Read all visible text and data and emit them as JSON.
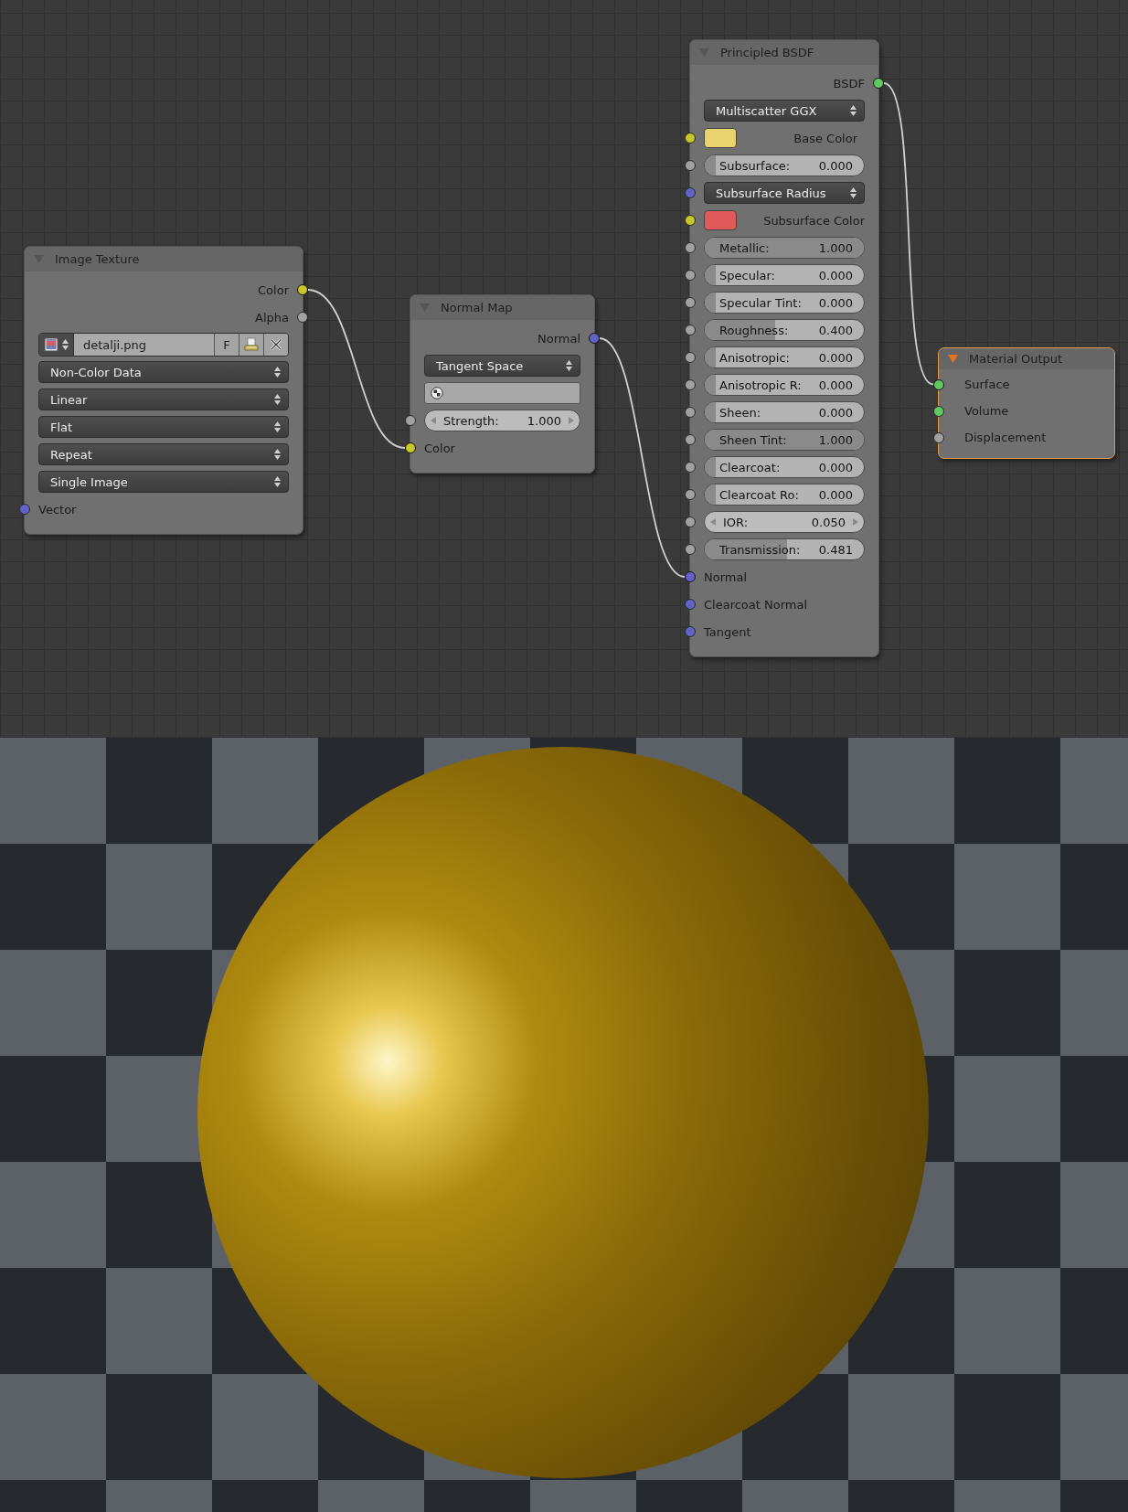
{
  "nodes": [
    {
      "title": "Image Texture",
      "selected": false,
      "rows": [
        {
          "kind": "output",
          "label": "Color",
          "socket": {
            "color": "#c7c729",
            "linked": true
          }
        },
        {
          "kind": "output",
          "label": "Alpha",
          "socket": {
            "color": "#a1a1a1"
          }
        },
        {
          "kind": "file",
          "name": "detalji.png",
          "button": "F"
        },
        {
          "kind": "dropdown",
          "value": "Non-Color Data"
        },
        {
          "kind": "dropdown",
          "value": "Linear"
        },
        {
          "kind": "dropdown",
          "value": "Flat"
        },
        {
          "kind": "dropdown",
          "value": "Repeat"
        },
        {
          "kind": "dropdown",
          "value": "Single Image"
        },
        {
          "kind": "input",
          "label": "Vector",
          "socket": {
            "color": "#6363c7"
          }
        }
      ]
    },
    {
      "title": "Normal Map",
      "selected": false,
      "rows": [
        {
          "kind": "output",
          "label": "Normal",
          "socket": {
            "color": "#6363c7",
            "linked": true
          }
        },
        {
          "kind": "dropdown",
          "value": "Tangent Space"
        },
        {
          "kind": "field"
        },
        {
          "kind": "number",
          "label": "Strength:",
          "value": "1.000",
          "socket": {
            "color": "#a1a1a1"
          }
        },
        {
          "kind": "input",
          "label": "Color",
          "socket": {
            "color": "#c7c729",
            "linked": true
          }
        }
      ]
    },
    {
      "title": "Principled BSDF",
      "selected": false,
      "rows": [
        {
          "kind": "output",
          "label": "BSDF",
          "socket": {
            "color": "#63c763",
            "linked": true
          }
        },
        {
          "kind": "dropdown",
          "value": "Multiscatter GGX"
        },
        {
          "kind": "color",
          "label": "Base Color",
          "color": "#e8d46e",
          "socket": {
            "color": "#c7c729"
          }
        },
        {
          "kind": "slider",
          "label": "Subsurface:",
          "value": "0.000",
          "level": 0,
          "socket": {
            "color": "#a1a1a1"
          }
        },
        {
          "kind": "dropdown",
          "value": "Subsurface Radius",
          "socket": {
            "color": "#6363c7"
          }
        },
        {
          "kind": "color",
          "label": "Subsurface Color",
          "color": "#e05a5a",
          "socket": {
            "color": "#c7c729"
          }
        },
        {
          "kind": "slider",
          "label": "Metallic:",
          "value": "1.000",
          "level": 1,
          "socket": {
            "color": "#a1a1a1"
          }
        },
        {
          "kind": "slider",
          "label": "Specular:",
          "value": "0.000",
          "level": 0,
          "socket": {
            "color": "#a1a1a1"
          }
        },
        {
          "kind": "slider",
          "label": "Specular Tint:",
          "value": "0.000",
          "level": 0,
          "socket": {
            "color": "#a1a1a1"
          }
        },
        {
          "kind": "slider",
          "label": "Roughness:",
          "value": "0.400",
          "level": 0.4,
          "socket": {
            "color": "#a1a1a1"
          }
        },
        {
          "kind": "slider",
          "label": "Anisotropic:",
          "value": "0.000",
          "level": 0,
          "socket": {
            "color": "#a1a1a1"
          }
        },
        {
          "kind": "slider",
          "label": "Anisotropic R:",
          "value": "0.000",
          "level": 0,
          "socket": {
            "color": "#a1a1a1"
          }
        },
        {
          "kind": "slider",
          "label": "Sheen:",
          "value": "0.000",
          "level": 0,
          "socket": {
            "color": "#a1a1a1"
          }
        },
        {
          "kind": "slider",
          "label": "Sheen Tint:",
          "value": "1.000",
          "level": 1,
          "socket": {
            "color": "#a1a1a1"
          }
        },
        {
          "kind": "slider",
          "label": "Clearcoat:",
          "value": "0.000",
          "level": 0,
          "socket": {
            "color": "#a1a1a1"
          }
        },
        {
          "kind": "slider",
          "label": "Clearcoat Ro:",
          "value": "0.000",
          "level": 0,
          "socket": {
            "color": "#a1a1a1"
          }
        },
        {
          "kind": "number",
          "label": "IOR:",
          "value": "0.050",
          "socket": {
            "color": "#a1a1a1"
          }
        },
        {
          "kind": "slider",
          "label": "Transmission:",
          "value": "0.481",
          "level": 0.481,
          "socket": {
            "color": "#a1a1a1"
          }
        },
        {
          "kind": "input",
          "label": "Normal",
          "socket": {
            "color": "#6363c7",
            "linked": true
          }
        },
        {
          "kind": "input",
          "label": "Clearcoat Normal",
          "socket": {
            "color": "#6363c7"
          }
        },
        {
          "kind": "input",
          "label": "Tangent",
          "socket": {
            "color": "#6363c7"
          }
        }
      ]
    },
    {
      "title": "Material Output",
      "selected": true,
      "rows": [
        {
          "kind": "input",
          "label": "Surface",
          "socket": {
            "color": "#63c763",
            "linked": true
          }
        },
        {
          "kind": "input",
          "label": "Volume",
          "socket": {
            "color": "#63c763"
          }
        },
        {
          "kind": "input",
          "label": "Displacement",
          "socket": {
            "color": "#a1a1a1"
          }
        }
      ]
    }
  ]
}
